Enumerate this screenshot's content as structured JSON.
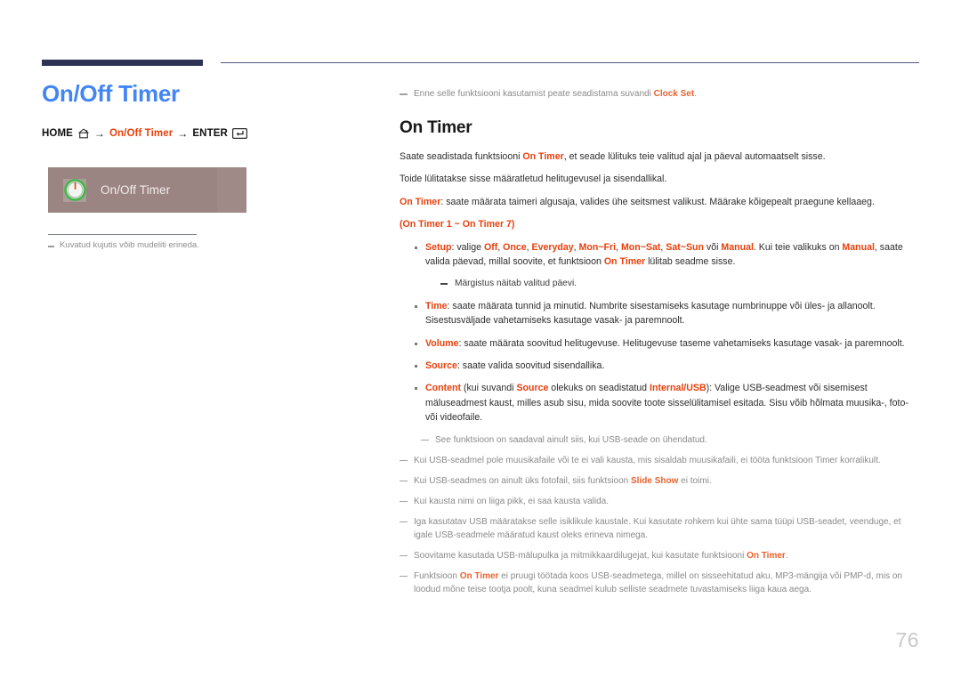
{
  "header": {
    "rule_color": "#2e3355"
  },
  "left": {
    "page_title": "On/Off Timer",
    "breadcrumb": {
      "home_label": "HOME",
      "home_icon": "home-icon",
      "arrow1": "→",
      "middle_label": "On/Off Timer",
      "arrow2": "→",
      "enter_label": "ENTER",
      "enter_icon": "enter-key-icon"
    },
    "menu_box": {
      "icon": "power-timer-knob-icon",
      "label": "On/Off Timer",
      "background": "#a08a87"
    },
    "note": "Kuvatud kujutis võib mudeliti erineda."
  },
  "right": {
    "top_note": {
      "before": "Enne selle funktsiooni kasutamist peate seadistama suvandi ",
      "accent": "Clock Set",
      "after": "."
    },
    "section_title": "On Timer",
    "para1": {
      "p1": "Saate seadistada funktsiooni ",
      "a1": "On Timer",
      "p2": ", et seade lülituks teie valitud ajal ja päeval automaatselt sisse."
    },
    "para2": "Toide lülitatakse sisse määratletud helitugevusel ja sisendallikal.",
    "para3": {
      "a1": "On Timer",
      "p1": ": saate määrata taimeri algusaja, valides ühe seitsmest valikust. Määrake kõigepealt praegune kellaaeg."
    },
    "range_line": {
      "open": "(",
      "a1": "On Timer 1 ~ On Timer 7",
      "close": ")"
    },
    "bullets": [
      {
        "term": "Setup",
        "segments": ": valige Off, Once, Everyday, Mon~Fri, Mon~Sat, Sat~Sun või Manual. Kui teie valikuks on Manual, saate valida päevad, millal soovite, et funktsioon On Timer lülitab seadme sisse."
      },
      {
        "term": "Time",
        "segments": ": saate määrata tunnid ja minutid. Numbrite sisestamiseks kasutage numbrinuppe või üles- ja allanoolt. Sisestusväljade vahetamiseks kasutage vasak- ja paremnoolt."
      },
      {
        "term": "Volume",
        "segments": ": saate määrata soovitud helitugevuse. Helitugevuse taseme vahetamiseks kasutage vasak- ja paremnoolt."
      },
      {
        "term": "Source",
        "segments": ": saate valida soovitud sisendallika."
      },
      {
        "term": "Content",
        "segments": " (kui suvandi Source olekuks on seadistatud Internal/USB): Valige USB-seadmest või sisemisest mäluseadmest kaust, milles asub sisu, mida soovite toote sisselülitamisel esitada. Sisu võib hõlmata muusika-, foto- või videofaile."
      }
    ],
    "setup_options": [
      "Off",
      "Once",
      "Everyday",
      "Mon~Fri",
      "Mon~Sat",
      "Sat~Sun",
      "Manual"
    ],
    "setup_subnote": "Märgistus näitab valitud päevi.",
    "content_subnote": "See funktsioon on saadaval ainult siis, kui USB-seade on ühendatud.",
    "notes": [
      "Kui USB-seadmel pole muusikafaile või te ei vali kausta, mis sisaldab muusikafaili, ei tööta funktsioon Timer korralikult.",
      "Kui USB-seadmes on ainult üks fotofail, siis funktsioon Slide Show ei toimi.",
      "Kui kausta nimi on liiga pikk, ei saa kausta valida.",
      "Iga kasutatav USB määratakse selle isiklikule kaustale. Kui kasutate rohkem kui ühte sama tüüpi USB-seadet, veenduge, et igale USB-seadmele määratud kaust oleks erineva nimega.",
      "Soovitame kasutada USB-mälupulka ja mitmikkaardilugejat, kui kasutate funktsiooni On Timer.",
      "Funktsioon On Timer ei pruugi töötada koos USB-seadmetega, millel on sisseehitatud aku, MP3-mängija või PMP-d, mis on loodud mõne teise tootja poolt, kuna seadmel kulub selliste seadmete tuvastamiseks liiga kaua aega."
    ]
  },
  "footer": {
    "page_number": "76"
  },
  "colors": {
    "accent_red": "#e8400c",
    "title_blue": "#4285f4",
    "header_navy": "#2e3355",
    "menu_bg": "#a08a87"
  }
}
